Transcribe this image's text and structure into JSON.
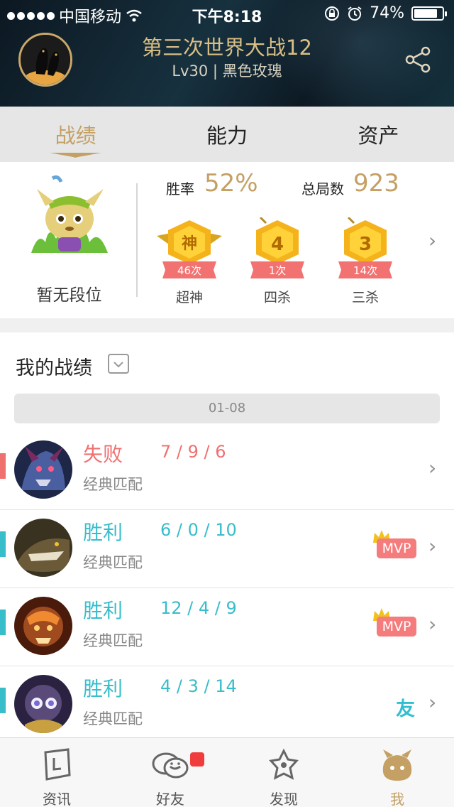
{
  "status_bar": {
    "carrier": "中国移动",
    "time": "下午8:18",
    "battery": "74%",
    "battery_level": 0.74
  },
  "profile": {
    "name": "第三次世界大战12",
    "level_server": "Lv30 | 黑色玫瑰",
    "share_icon": "share-icon"
  },
  "tabs": [
    {
      "label": "战绩",
      "active": true
    },
    {
      "label": "能力",
      "active": false
    },
    {
      "label": "资产",
      "active": false
    }
  ],
  "stats": {
    "rank_label": "暂无段位",
    "win_rate_label": "胜率",
    "win_rate": "52%",
    "total_games_label": "总局数",
    "total_games": "923",
    "badges": [
      {
        "glyph": "神",
        "count": "46次",
        "label": "超神"
      },
      {
        "glyph": "4",
        "count": "1次",
        "label": "四杀"
      },
      {
        "glyph": "3",
        "count": "14次",
        "label": "三杀"
      }
    ]
  },
  "records": {
    "title": "我的战绩",
    "date": "01-08",
    "matches": [
      {
        "result": "失败",
        "kda": "7 / 9 / 6",
        "mode": "经典匹配",
        "outcome": "loss",
        "tag": "",
        "hero_color": "#3a4a7a"
      },
      {
        "result": "胜利",
        "kda": "6 / 0 / 10",
        "mode": "经典匹配",
        "outcome": "win",
        "tag": "MVP",
        "hero_color": "#5a4a30"
      },
      {
        "result": "胜利",
        "kda": "12 / 4 / 9",
        "mode": "经典匹配",
        "outcome": "win",
        "tag": "MVP",
        "hero_color": "#8a3a1a"
      },
      {
        "result": "胜利",
        "kda": "4 / 3 / 14",
        "mode": "经典匹配",
        "outcome": "win",
        "tag": "友",
        "hero_color": "#3a2f5a"
      }
    ]
  },
  "bottom_nav": [
    {
      "label": "资讯",
      "icon": "news-icon",
      "active": false
    },
    {
      "label": "好友",
      "icon": "friends-icon",
      "active": false,
      "badge": true
    },
    {
      "label": "发现",
      "icon": "discover-icon",
      "active": false
    },
    {
      "label": "我",
      "icon": "me-icon",
      "active": true
    }
  ],
  "colors": {
    "gold": "#c4a064",
    "loss": "#f07070",
    "win": "#38bdcb",
    "mvp": "#f57c7c"
  }
}
